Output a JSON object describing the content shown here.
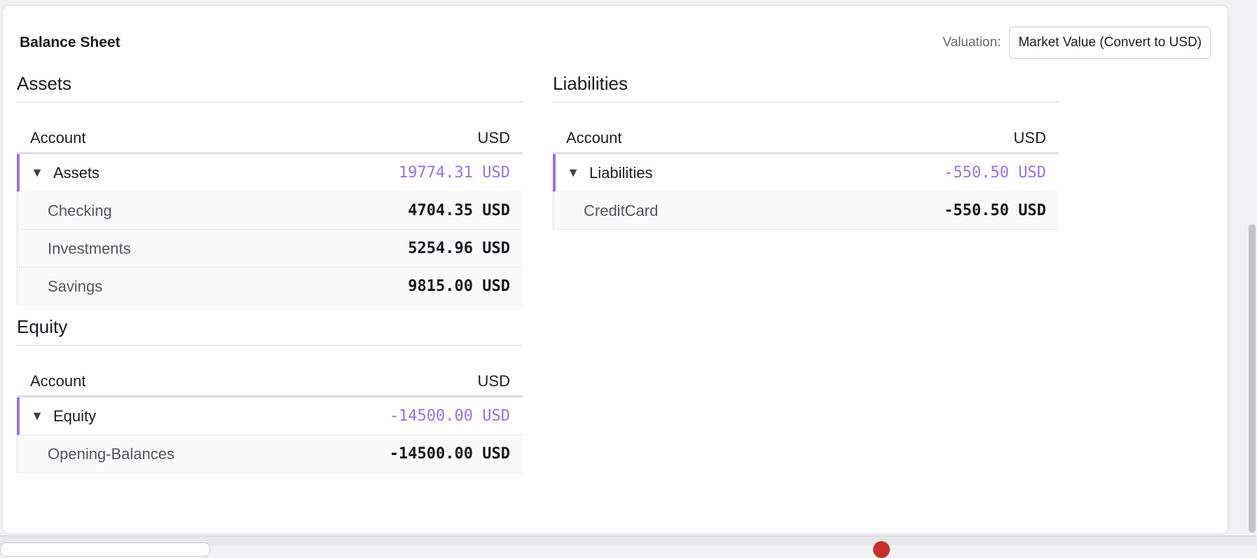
{
  "header": {
    "title": "Balance Sheet",
    "valuation_label": "Valuation:",
    "valuation_value": "Market Value (Convert to USD)"
  },
  "sections": {
    "assets": {
      "title": "Assets",
      "col_account": "Account",
      "col_currency": "USD",
      "group": {
        "name": "Assets",
        "amount": "19774.31 USD"
      },
      "children": [
        {
          "name": "Checking",
          "amount": "4704.35 USD"
        },
        {
          "name": "Investments",
          "amount": "5254.96 USD"
        },
        {
          "name": "Savings",
          "amount": "9815.00 USD"
        }
      ]
    },
    "liabilities": {
      "title": "Liabilities",
      "col_account": "Account",
      "col_currency": "USD",
      "group": {
        "name": "Liabilities",
        "amount": "-550.50 USD"
      },
      "children": [
        {
          "name": "CreditCard",
          "amount": "-550.50 USD"
        }
      ]
    },
    "equity": {
      "title": "Equity",
      "col_account": "Account",
      "col_currency": "USD",
      "group": {
        "name": "Equity",
        "amount": "-14500.00 USD"
      },
      "children": [
        {
          "name": "Opening-Balances",
          "amount": "-14500.00 USD"
        }
      ]
    }
  },
  "icons": {
    "expanded_toggle": "triangle-down-icon"
  },
  "colors": {
    "accent": "#9b72e8",
    "background": "#ffffff",
    "text": "#1f1f24",
    "muted": "#6b6b72"
  }
}
